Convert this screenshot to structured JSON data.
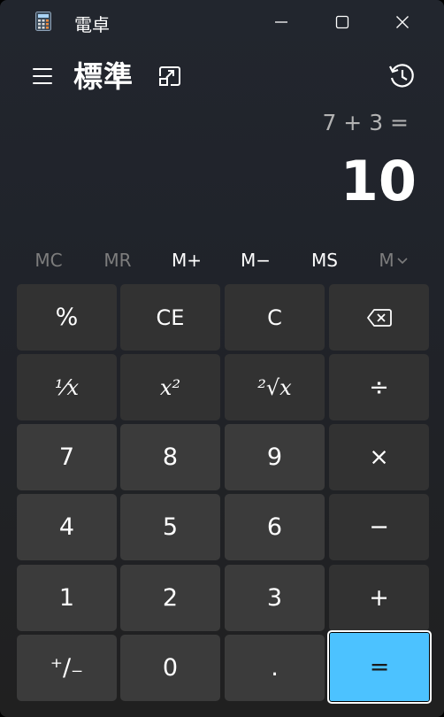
{
  "window": {
    "title": "電卓"
  },
  "header": {
    "mode": "標準"
  },
  "display": {
    "expression": "7 + 3 =",
    "result": "10"
  },
  "memory": [
    {
      "label": "MC",
      "enabled": false
    },
    {
      "label": "MR",
      "enabled": false
    },
    {
      "label": "M+",
      "enabled": true
    },
    {
      "label": "M−",
      "enabled": true
    },
    {
      "label": "MS",
      "enabled": true
    },
    {
      "label": "M",
      "enabled": false
    }
  ],
  "keys": {
    "percent": "%",
    "ce": "CE",
    "c": "C",
    "backspace_icon": "backspace-icon",
    "reciprocal": "¹⁄x",
    "square": "x²",
    "sqrt": "²√x",
    "divide": "÷",
    "seven": "7",
    "eight": "8",
    "nine": "9",
    "multiply": "×",
    "four": "4",
    "five": "5",
    "six": "6",
    "minus": "−",
    "one": "1",
    "two": "2",
    "three": "3",
    "plus": "+",
    "negate": "⁺∕₋",
    "zero": "0",
    "decimal": ".",
    "equals": "="
  },
  "colors": {
    "accent": "#4cc2ff",
    "function_key": "#323232",
    "number_key": "#3b3b3b"
  }
}
